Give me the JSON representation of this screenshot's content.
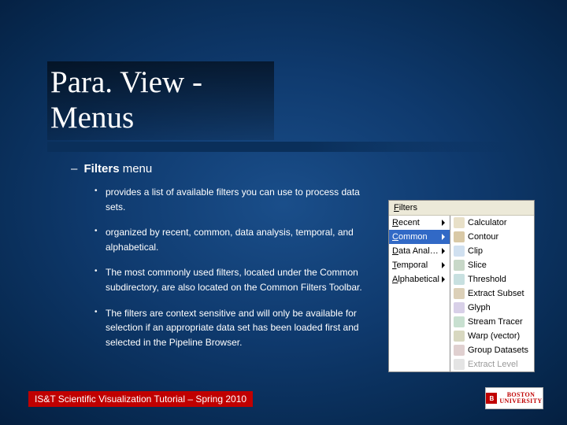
{
  "title": "Para. View - Menus",
  "subhead": {
    "dash": "–",
    "bold": "Filters",
    "rest": " menu"
  },
  "bullets": [
    "provides a list of available filters you can use to process data sets.",
    "organized by recent, common, data analysis, temporal, and alphabetical.",
    "The most commonly used filters, located under the Common subdirectory, are also located on the Common Filters Toolbar.",
    "The filters are context sensitive and will only be available for selection if an appropriate data set has been loaded first and selected in the Pipeline Browser."
  ],
  "menu": {
    "header": "Filters",
    "left": [
      {
        "label": "Recent",
        "hl": false
      },
      {
        "label": "Common",
        "hl": true
      },
      {
        "label": "Data Analysis",
        "hl": false
      },
      {
        "label": "Temporal",
        "hl": false
      },
      {
        "label": "Alphabetical",
        "hl": false
      }
    ],
    "right": [
      {
        "label": "Calculator",
        "iconClass": "ic-calc",
        "disabled": false
      },
      {
        "label": "Contour",
        "iconClass": "ic-cont",
        "disabled": false
      },
      {
        "label": "Clip",
        "iconClass": "ic-clip",
        "disabled": false
      },
      {
        "label": "Slice",
        "iconClass": "ic-slice",
        "disabled": false
      },
      {
        "label": "Threshold",
        "iconClass": "ic-thresh",
        "disabled": false
      },
      {
        "label": "Extract Subset",
        "iconClass": "ic-ext",
        "disabled": false
      },
      {
        "label": "Glyph",
        "iconClass": "ic-glyph",
        "disabled": false
      },
      {
        "label": "Stream Tracer",
        "iconClass": "ic-stream",
        "disabled": false
      },
      {
        "label": "Warp (vector)",
        "iconClass": "ic-warp",
        "disabled": false
      },
      {
        "label": "Group Datasets",
        "iconClass": "ic-group",
        "disabled": false
      },
      {
        "label": "Extract Level",
        "iconClass": "ic-extl",
        "disabled": true
      }
    ]
  },
  "footer": "IS&T Scientific Visualization Tutorial – Spring 2010",
  "logo": {
    "line1": "BOSTON",
    "line2": "UNIVERSITY"
  }
}
